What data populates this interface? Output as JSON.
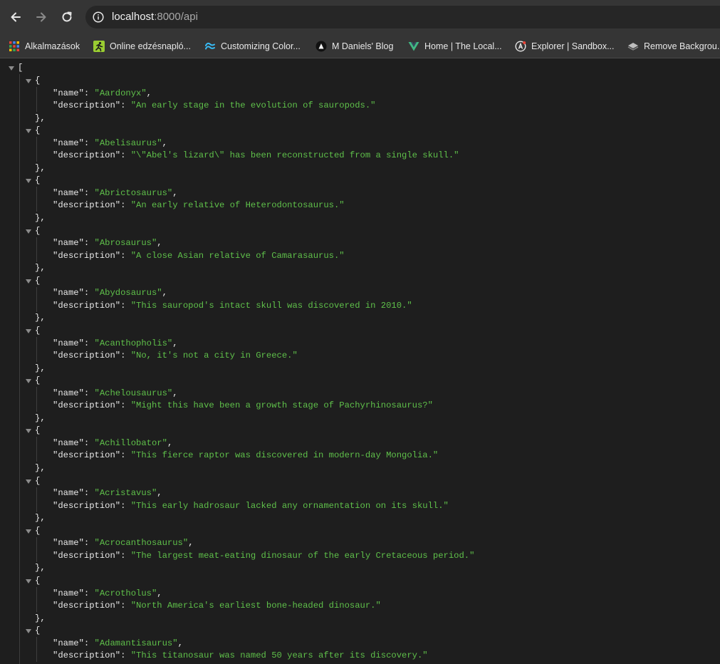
{
  "browser": {
    "url_host": "localhost",
    "url_path": ":8000/api",
    "bookmarks": [
      {
        "label": "Alkalmazások",
        "icon": "apps-grid-icon"
      },
      {
        "label": "Online edzésnapló...",
        "icon": "runner-icon"
      },
      {
        "label": "Customizing Color...",
        "icon": "tailwind-icon"
      },
      {
        "label": "M Daniels' Blog",
        "icon": "blog-logo-icon"
      },
      {
        "label": "Home | The Local...",
        "icon": "vue-logo-icon"
      },
      {
        "label": "Explorer | Sandbox...",
        "icon": "apollo-logo-icon"
      },
      {
        "label": "Remove Backgrou...",
        "icon": "layers-icon"
      }
    ]
  },
  "json": {
    "open_bracket": "[",
    "key_name": "\"name\"",
    "key_description": "\"description\"",
    "entries": [
      {
        "name": "\"Aardonyx\"",
        "description": "\"An early stage in the evolution of sauropods.\""
      },
      {
        "name": "\"Abelisaurus\"",
        "description": "\"\\\"Abel's lizard\\\" has been reconstructed from a single skull.\""
      },
      {
        "name": "\"Abrictosaurus\"",
        "description": "\"An early relative of Heterodontosaurus.\""
      },
      {
        "name": "\"Abrosaurus\"",
        "description": "\"A close Asian relative of Camarasaurus.\""
      },
      {
        "name": "\"Abydosaurus\"",
        "description": "\"This sauropod's intact skull was discovered in 2010.\""
      },
      {
        "name": "\"Acanthopholis\"",
        "description": "\"No, it's not a city in Greece.\""
      },
      {
        "name": "\"Achelousaurus\"",
        "description": "\"Might this have been a growth stage of Pachyrhinosaurus?\""
      },
      {
        "name": "\"Achillobator\"",
        "description": "\"This fierce raptor was discovered in modern-day Mongolia.\""
      },
      {
        "name": "\"Acristavus\"",
        "description": "\"This early hadrosaur lacked any ornamentation on its skull.\""
      },
      {
        "name": "\"Acrocanthosaurus\"",
        "description": "\"The largest meat-eating dinosaur of the early Cretaceous period.\""
      },
      {
        "name": "\"Acrotholus\"",
        "description": "\"North America's earliest bone-headed dinosaur.\""
      },
      {
        "name": "\"Adamantisaurus\"",
        "description": "\"This titanosaur was named 50 years after its discovery.\""
      }
    ]
  },
  "colors": {
    "string": "#5fc04a",
    "background": "#1e1e1e",
    "toolbar": "#353535"
  }
}
